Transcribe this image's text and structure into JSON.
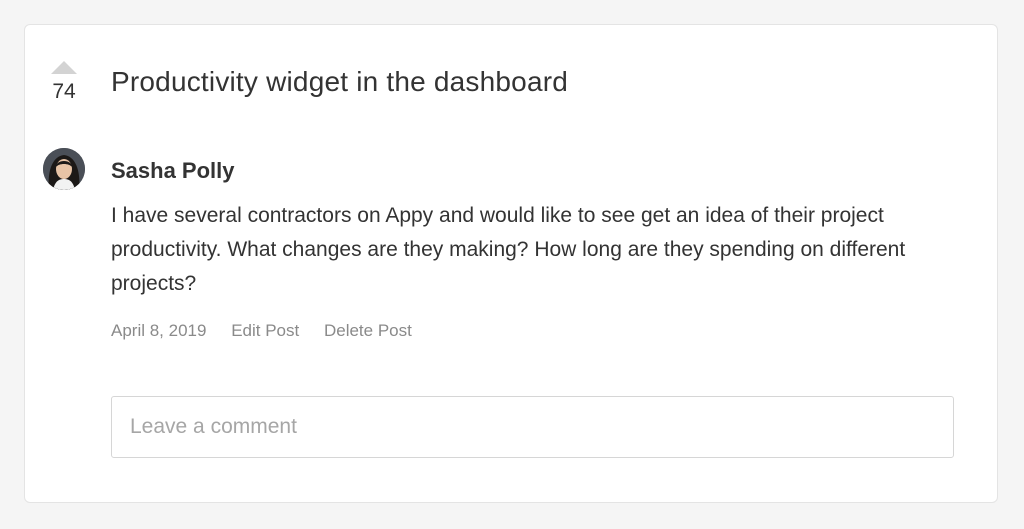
{
  "post": {
    "votes": "74",
    "title": "Productivity widget in the dashboard",
    "author": "Sasha Polly",
    "body": "I have several contractors on Appy and would like to see get an idea of their project productivity. What changes are they making? How long are they spending on different projects?",
    "date": "April 8, 2019",
    "edit_label": "Edit Post",
    "delete_label": "Delete Post"
  },
  "comment": {
    "placeholder": "Leave a comment"
  },
  "colors": {
    "text": "#333333",
    "muted": "#8a8a8a",
    "arrow": "#d3d3d3",
    "border": "#d6d6d6"
  },
  "icons": {
    "upvote": "upvote-arrow-icon"
  }
}
